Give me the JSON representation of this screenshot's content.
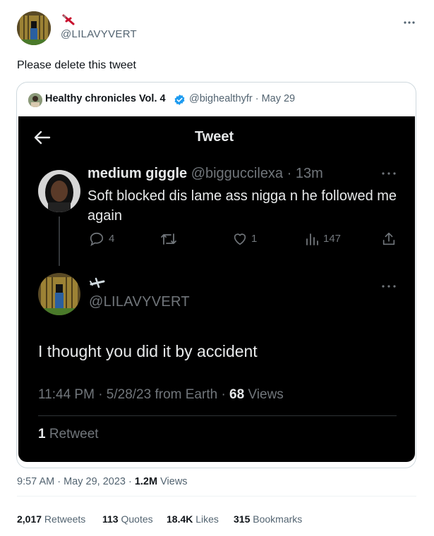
{
  "tweet": {
    "handle": "@LILAVYVERT",
    "text": "Please delete this tweet",
    "timestamp": "9:57 AM · May 29, 2023 · ",
    "views_count": "1.2M",
    "views_label": " Views"
  },
  "quote": {
    "author_name": "Healthy chronicles Vol. 4",
    "author_handle": "@bighealthyfr",
    "date": " · May 29",
    "verified_color": "#1d9bf0",
    "screenshot": {
      "header_title": "Tweet",
      "reply_to": {
        "name": "medium giggle",
        "handle": "@bigguccilexa",
        "time": "· 13m",
        "text": "Soft blocked dis lame ass nigga n he followed me again",
        "replies": "4",
        "likes": "1",
        "views": "147"
      },
      "main": {
        "handle": "@LILAVYVERT",
        "text": "I thought you did it by accident",
        "meta_prefix": "11:44 PM · 5/28/23 from Earth · ",
        "views_count": "68",
        "views_label": " Views",
        "retweets_count": "1",
        "retweets_label": " Retweet"
      }
    }
  },
  "stats": {
    "retweets_count": "2,017",
    "retweets_label": " Retweets",
    "quotes_count": "113",
    "quotes_label": " Quotes",
    "likes_count": "18.4K",
    "likes_label": " Likes",
    "bookmarks_count": "315",
    "bookmarks_label": " Bookmarks"
  }
}
